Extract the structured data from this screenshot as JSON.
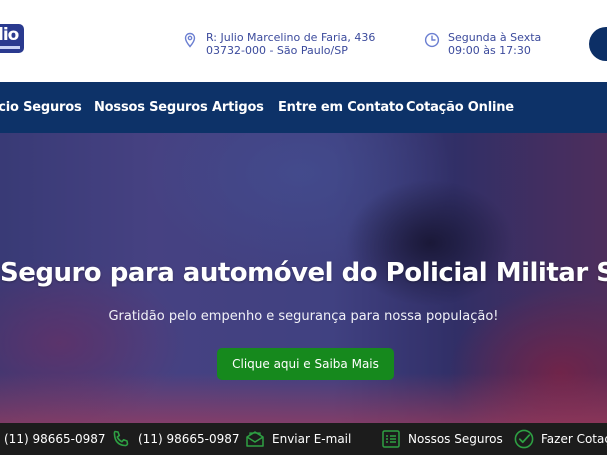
{
  "header": {
    "logo_text": "lio",
    "address_line1": "R: Julio Marcelino de Faria, 436",
    "address_line2": "03732-000 - São Paulo/SP",
    "hours_line1": "Segunda à Sexta",
    "hours_line2": "09:00 às 17:30",
    "accent": "#3b4a9c"
  },
  "nav": {
    "items": [
      {
        "label": "ício Seguros"
      },
      {
        "label": "Nossos Seguros"
      },
      {
        "label": "Artigos"
      },
      {
        "label": "Entre em Contato"
      },
      {
        "label": "Cotação Online"
      }
    ],
    "background": "#0d3268"
  },
  "hero": {
    "title": "Seguro para automóvel do Policial Militar SP",
    "subtitle": "Gratidão pelo empenho e segurança para nossa população!",
    "button_label": "Clique aqui e Saiba Mais",
    "button_color": "#16891d"
  },
  "bottom_bar": {
    "items": [
      {
        "label": "(11) 98665-0987",
        "icon": "phone-icon"
      },
      {
        "label": "(11) 98665-0987",
        "icon": "phone-icon"
      },
      {
        "label": "Enviar E-mail",
        "icon": "mail-icon"
      },
      {
        "label": "Nossos Seguros",
        "icon": "list-icon"
      },
      {
        "label": "Fazer Cotação",
        "icon": "check-circle-icon"
      }
    ],
    "icon_color": "#2ea043",
    "background": "#1c1c1c"
  }
}
